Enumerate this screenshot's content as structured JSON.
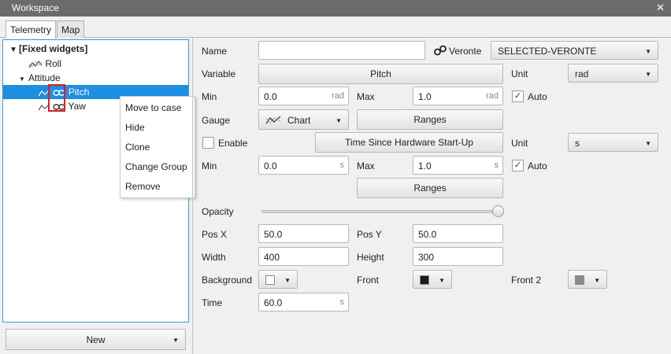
{
  "window": {
    "title": "Workspace",
    "close_glyph": "✕"
  },
  "tabs": [
    {
      "label": "Telemetry",
      "active": true
    },
    {
      "label": "Map",
      "active": false
    }
  ],
  "tree": {
    "root": "[Fixed widgets]",
    "roll": "Roll",
    "group": "Attitude",
    "pitch": "Pitch",
    "yaw": "Yaw"
  },
  "context_menu": {
    "items": [
      "Move to case",
      "Hide",
      "Clone",
      "Change Group",
      "Remove"
    ]
  },
  "new_button": {
    "label": "New"
  },
  "form": {
    "name_label": "Name",
    "name_value": "",
    "veronte_label": "Veronte",
    "veronte_value": "SELECTED-VERONTE",
    "variable_label": "Variable",
    "variable_value": "Pitch",
    "unit_label": "Unit",
    "unit_value": "rad",
    "min_label": "Min",
    "min_value": "0.0",
    "min_unit": "rad",
    "max_label": "Max",
    "max_value": "1.0",
    "max_unit": "rad",
    "auto_label": "Auto",
    "gauge_label": "Gauge",
    "gauge_value": "Chart",
    "ranges_label": "Ranges",
    "enable_label": "Enable",
    "time_var_value": "Time Since Hardware Start-Up",
    "unit2_value": "s",
    "min2_value": "0.0",
    "min2_unit": "s",
    "max2_value": "1.0",
    "max2_unit": "s",
    "opacity_label": "Opacity",
    "opacity_value": 1.0,
    "posx_label": "Pos X",
    "posx_value": "50.0",
    "posy_label": "Pos Y",
    "posy_value": "50.0",
    "width_label": "Width",
    "width_value": "400",
    "height_label": "Height",
    "height_value": "300",
    "background_label": "Background",
    "front_label": "Front",
    "front2_label": "Front 2",
    "time_label": "Time",
    "time_value": "60.0",
    "time_unit": "s"
  },
  "colors": {
    "accent": "#1e8ee0",
    "background_swatch": "#ffffff",
    "front_swatch": "#1a1a1a",
    "front2_swatch": "#8c8c8c",
    "highlight": "#e31b1b"
  }
}
